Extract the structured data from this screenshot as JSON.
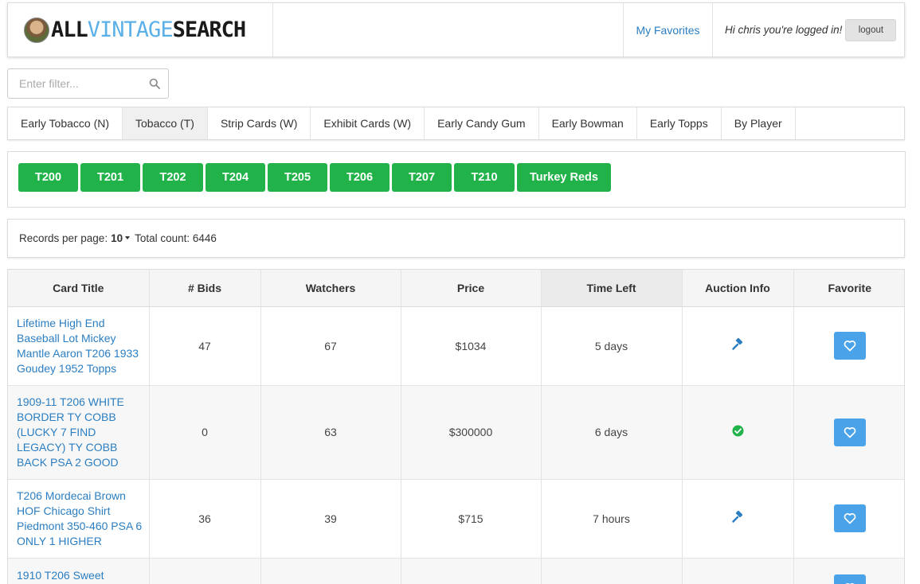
{
  "header": {
    "logo_all": "ALL",
    "logo_vintage": "VINTAGE",
    "logo_search": "SEARCH",
    "favorites_label": "My Favorites",
    "greeting": "Hi chris you're logged in!",
    "logout_label": "logout"
  },
  "filter": {
    "placeholder": "Enter filter..."
  },
  "tabs": [
    {
      "label": "Early Tobacco (N)",
      "active": false
    },
    {
      "label": "Tobacco (T)",
      "active": true
    },
    {
      "label": "Strip Cards (W)",
      "active": false
    },
    {
      "label": "Exhibit Cards (W)",
      "active": false
    },
    {
      "label": "Early Candy Gum",
      "active": false
    },
    {
      "label": "Early Bowman",
      "active": false
    },
    {
      "label": "Early Topps",
      "active": false
    },
    {
      "label": "By Player",
      "active": false
    }
  ],
  "series_buttons": [
    "T200",
    "T201",
    "T202",
    "T204",
    "T205",
    "T206",
    "T207",
    "T210",
    "Turkey Reds"
  ],
  "records": {
    "per_page_label": "Records per page:",
    "per_page_value": "10",
    "total_label": "Total count: 6446"
  },
  "table": {
    "headers": [
      "Card Title",
      "# Bids",
      "Watchers",
      "Price",
      "Time Left",
      "Auction Info",
      "Favorite"
    ],
    "rows": [
      {
        "title": "Lifetime High End Baseball Lot Mickey Mantle Aaron T206 1933 Goudey 1952 Topps",
        "bids": "47",
        "watchers": "67",
        "price": "$1034",
        "time_left": "5 days",
        "info_icon": "gavel-icon"
      },
      {
        "title": "1909-11 T206 WHITE BORDER TY COBB (LUCKY 7 FIND LEGACY) TY COBB BACK PSA 2 GOOD",
        "bids": "0",
        "watchers": "63",
        "price": "$300000",
        "time_left": "6 days",
        "info_icon": "check-circle-icon"
      },
      {
        "title": "T206 Mordecai Brown HOF Chicago Shirt Piedmont 350-460 PSA 6 ONLY 1 HIGHER",
        "bids": "36",
        "watchers": "39",
        "price": "$715",
        "time_left": "7 hours",
        "info_icon": "gavel-icon"
      },
      {
        "title": "1910 T206 Sweet",
        "bids": "",
        "watchers": "",
        "price": "",
        "time_left": "",
        "info_icon": ""
      }
    ]
  },
  "colors": {
    "link_blue": "#2b7ec1",
    "series_green": "#21b34a",
    "favorite_blue": "#4aa3e8",
    "check_green": "#21b34a"
  }
}
